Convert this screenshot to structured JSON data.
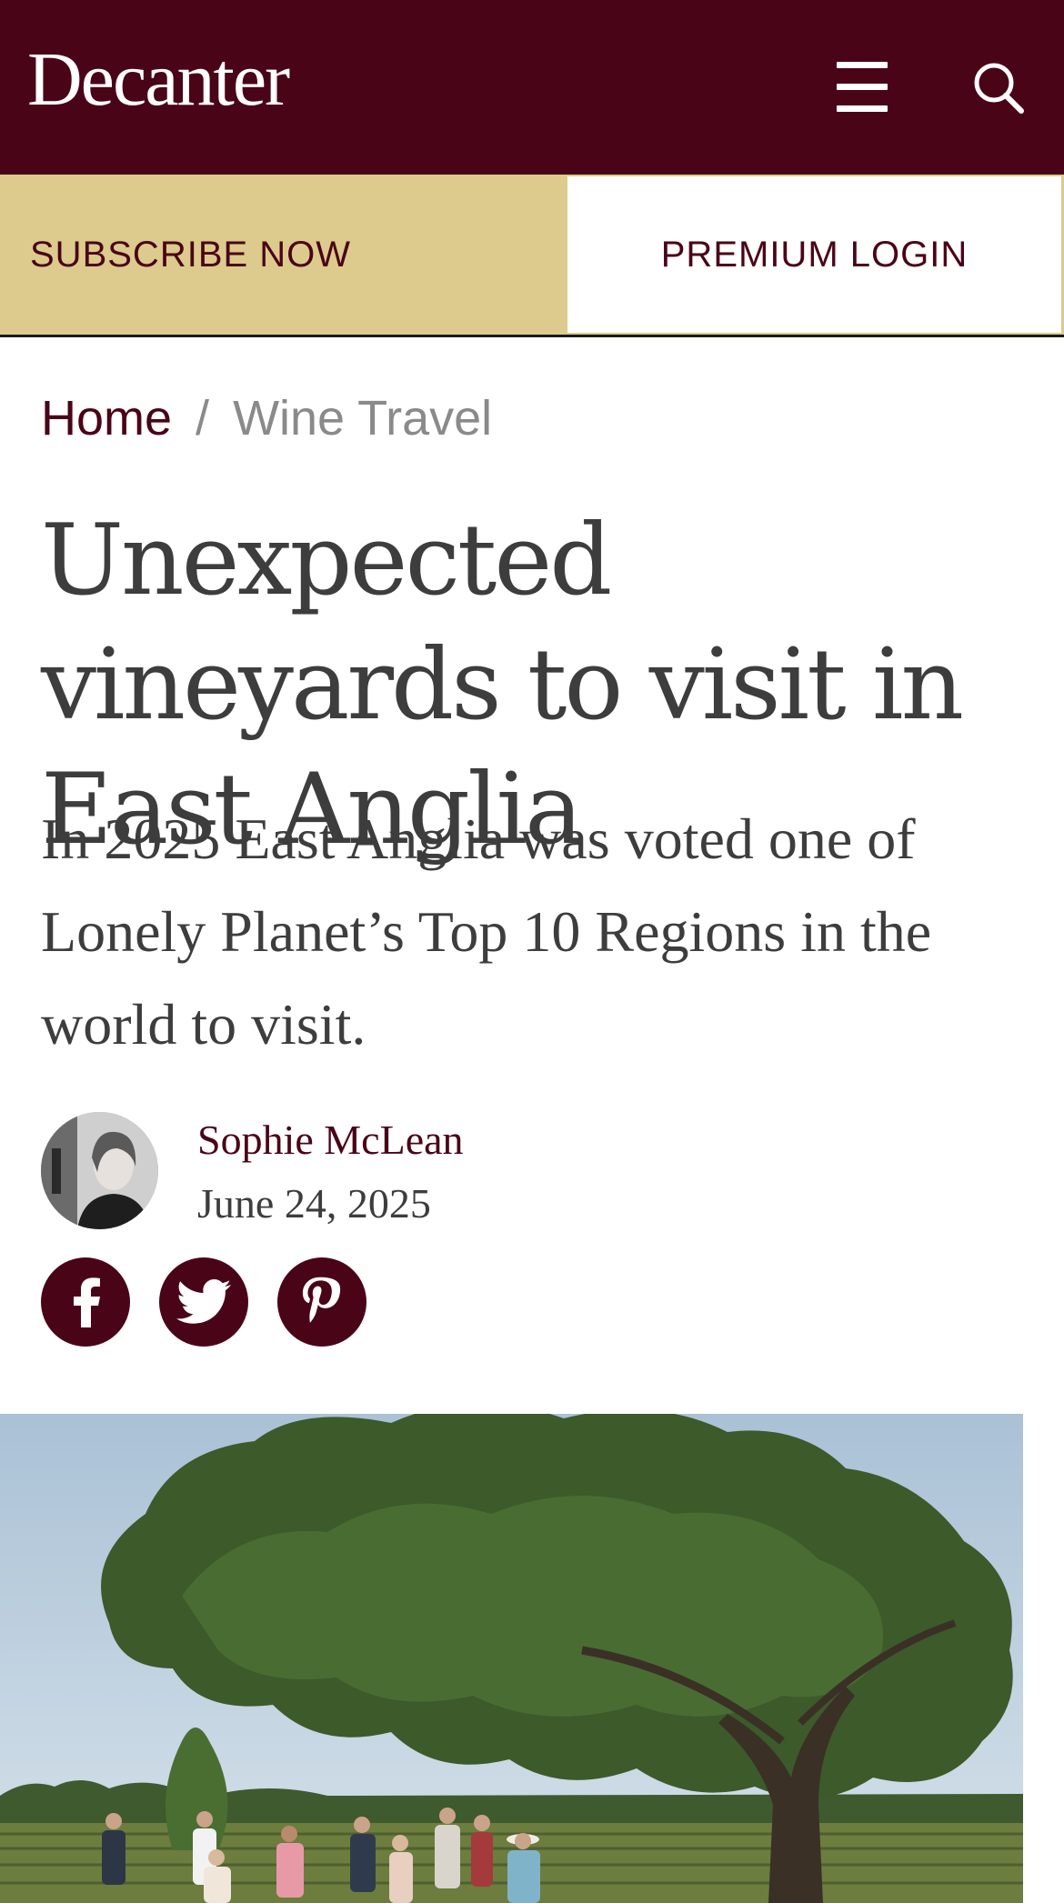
{
  "header": {
    "logo_text": "Decanter",
    "menu_icon": "hamburger-menu-icon",
    "search_icon": "search-icon",
    "background_color": "#4a0418"
  },
  "subscription": {
    "subscribe_label": "SUBSCRIBE NOW",
    "login_label": "PREMIUM LOGIN",
    "subscribe_color": "#dccb8c"
  },
  "breadcrumb": {
    "home": "Home",
    "separator": "/",
    "current": "Wine Travel"
  },
  "article": {
    "title": "Unexpected vineyards to visit in East Anglia",
    "standfirst": "In 2025 East Anglia was voted one of Lonely Planet’s Top 10 Regions in the world to visit.",
    "author": "Sophie McLean",
    "date": "June 24, 2025"
  },
  "share": {
    "icons": [
      "facebook-icon",
      "twitter-icon",
      "pinterest-icon"
    ]
  },
  "hero_image": {
    "subject": "large oak tree above a vineyard with visitors walking between vines"
  }
}
